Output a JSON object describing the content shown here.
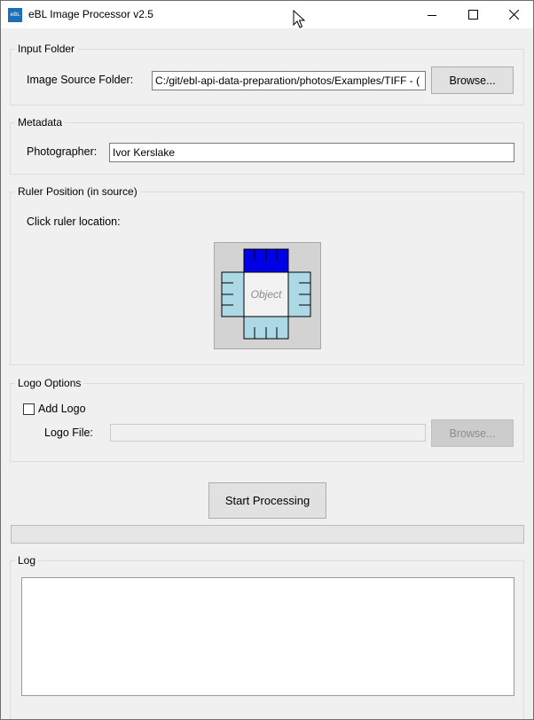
{
  "window": {
    "title": "eBL Image Processor v2.5",
    "icon_text": "eBL"
  },
  "input_folder": {
    "group_label": "Input Folder",
    "source_label": "Image Source Folder:",
    "source_value": "C:/git/ebl-api-data-preparation/photos/Examples/TIFF - (",
    "browse_label": "Browse..."
  },
  "metadata": {
    "group_label": "Metadata",
    "photographer_label": "Photographer:",
    "photographer_value": "Ivor Kerslake"
  },
  "ruler": {
    "group_label": "Ruler Position (in source)",
    "prompt": "Click ruler location:",
    "object_label": "Object",
    "selected_position": "top",
    "colors": {
      "selected": "#0000e6",
      "unselected": "#add8e6",
      "object": "#f2f2f2"
    }
  },
  "logo": {
    "group_label": "Logo Options",
    "add_logo_label": "Add Logo",
    "add_logo_checked": false,
    "file_label": "Logo File:",
    "file_value": "",
    "browse_label": "Browse..."
  },
  "actions": {
    "start_label": "Start Processing",
    "progress": 0
  },
  "log": {
    "group_label": "Log",
    "content": ""
  }
}
